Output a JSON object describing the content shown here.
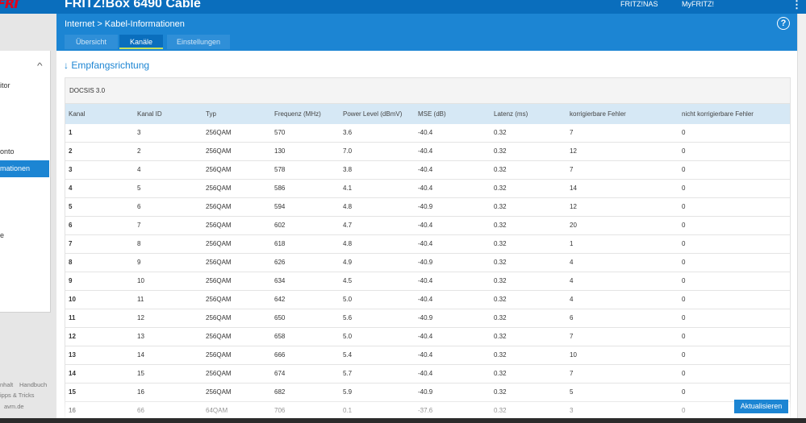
{
  "app": {
    "logo_text": "FRITZ!",
    "title": "FRITZ!Box 6490 Cable",
    "top_links": [
      "FRITZ!NAS",
      "MyFRITZ!"
    ],
    "kebab": "⋮"
  },
  "breadcrumb": {
    "parent": "Internet",
    "separator": ">",
    "current": "Kabel-Informationen"
  },
  "help_label": "?",
  "tabs": [
    {
      "label": "Übersicht",
      "active": false
    },
    {
      "label": "Kanäle",
      "active": true
    },
    {
      "label": "Einstellungen",
      "active": false
    }
  ],
  "sidebar": {
    "collapse_icon": "^",
    "items": [
      {
        "label": "itor",
        "active": false
      },
      {
        "label": "onto",
        "active": false
      },
      {
        "label": "mationen",
        "active": true
      },
      {
        "label": "e",
        "active": false
      }
    ],
    "footer": [
      "nhalt",
      "Handbuch",
      "ipps & Tricks",
      "avm.de"
    ]
  },
  "section_title": "↓ Empfangsrichtung",
  "table": {
    "caption": "DOCSIS 3.0",
    "columns": [
      "Kanal",
      "Kanal ID",
      "Typ",
      "Frequenz (MHz)",
      "Power Level (dBmV)",
      "MSE (dB)",
      "Latenz (ms)",
      "korrigierbare Fehler",
      "nicht korrigierbare Fehler"
    ],
    "rows": [
      [
        "1",
        "3",
        "256QAM",
        "570",
        "3.6",
        "-40.4",
        "0.32",
        "7",
        "0"
      ],
      [
        "2",
        "2",
        "256QAM",
        "130",
        "7.0",
        "-40.4",
        "0.32",
        "12",
        "0"
      ],
      [
        "3",
        "4",
        "256QAM",
        "578",
        "3.8",
        "-40.4",
        "0.32",
        "7",
        "0"
      ],
      [
        "4",
        "5",
        "256QAM",
        "586",
        "4.1",
        "-40.4",
        "0.32",
        "14",
        "0"
      ],
      [
        "5",
        "6",
        "256QAM",
        "594",
        "4.8",
        "-40.9",
        "0.32",
        "12",
        "0"
      ],
      [
        "6",
        "7",
        "256QAM",
        "602",
        "4.7",
        "-40.4",
        "0.32",
        "20",
        "0"
      ],
      [
        "7",
        "8",
        "256QAM",
        "618",
        "4.8",
        "-40.4",
        "0.32",
        "1",
        "0"
      ],
      [
        "8",
        "9",
        "256QAM",
        "626",
        "4.9",
        "-40.9",
        "0.32",
        "4",
        "0"
      ],
      [
        "9",
        "10",
        "256QAM",
        "634",
        "4.5",
        "-40.4",
        "0.32",
        "4",
        "0"
      ],
      [
        "10",
        "11",
        "256QAM",
        "642",
        "5.0",
        "-40.4",
        "0.32",
        "4",
        "0"
      ],
      [
        "11",
        "12",
        "256QAM",
        "650",
        "5.6",
        "-40.9",
        "0.32",
        "6",
        "0"
      ],
      [
        "12",
        "13",
        "256QAM",
        "658",
        "5.0",
        "-40.4",
        "0.32",
        "7",
        "0"
      ],
      [
        "13",
        "14",
        "256QAM",
        "666",
        "5.4",
        "-40.4",
        "0.32",
        "10",
        "0"
      ],
      [
        "14",
        "15",
        "256QAM",
        "674",
        "5.7",
        "-40.4",
        "0.32",
        "7",
        "0"
      ],
      [
        "15",
        "16",
        "256QAM",
        "682",
        "5.9",
        "-40.9",
        "0.32",
        "5",
        "0"
      ],
      [
        "16",
        "66",
        "64QAM",
        "706",
        "0.1",
        "-37.6",
        "0.32",
        "3",
        "0"
      ]
    ]
  },
  "refresh_label": "Aktualisieren",
  "colors": {
    "header_blue": "#0a6ebd",
    "accent_blue": "#1c85d3",
    "table_header": "#d6e8f5",
    "tab_underline": "#c6e05a"
  }
}
